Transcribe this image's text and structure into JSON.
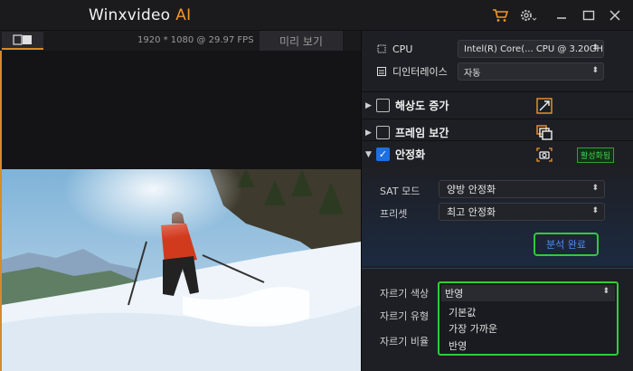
{
  "app": {
    "title": "Winxvideo",
    "title_ai": "AI"
  },
  "preview": {
    "resolution_text": "1920 * 1080 @ 29.97 FPS",
    "preview_tab_label": "미리 보기"
  },
  "hardware": {
    "cpu_label": "CPU",
    "cpu_value": "Intel(R) Core(... CPU @ 3.20GHz",
    "deinterlace_label": "디인터레이스",
    "deinterlace_value": "자동"
  },
  "sections": {
    "upscale_label": "해상도 증가",
    "frame_interp_label": "프레임 보간",
    "stabilize_label": "안정화",
    "stabilize_badge": "활성화됨"
  },
  "stabilization": {
    "sat_mode_label": "SAT 모드",
    "sat_mode_value": "양방 안정화",
    "preset_label": "프리셋",
    "preset_value": "최고 안정화",
    "analysis_button": "분석 완료"
  },
  "crop": {
    "color_label": "자르기 색상",
    "type_label": "자르기 유형",
    "ratio_label": "자르기 비율",
    "color_value": "반영",
    "options": [
      "기본값",
      "가장 가까운",
      "반영"
    ]
  },
  "colors": {
    "accent_orange": "#f0972a",
    "highlight_green": "#2fcc3a",
    "active_blue": "#1e6fe0"
  }
}
